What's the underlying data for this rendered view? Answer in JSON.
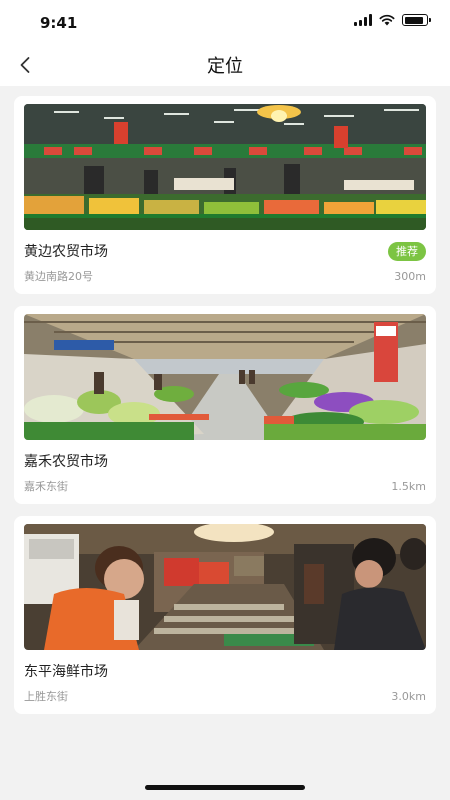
{
  "status_bar": {
    "time": "9:41",
    "battery_level": 0.9
  },
  "nav": {
    "title": "定位",
    "back_icon": "chevron-left-icon"
  },
  "markets": [
    {
      "name": "黄边农贸市场",
      "address": "黄边南路20号",
      "distance": "300m",
      "badge": "推荐",
      "photo": "produce-market-photo"
    },
    {
      "name": "嘉禾农贸市场",
      "address": "嘉禾东街",
      "distance": "1.5km",
      "badge": "",
      "photo": "vegetable-aisle-photo"
    },
    {
      "name": "东平海鲜市场",
      "address": "上胜东街",
      "distance": "3.0km",
      "badge": "",
      "photo": "seafood-market-photo"
    }
  ],
  "colors": {
    "badge": "#7cc443",
    "background": "#f2f2f2"
  }
}
